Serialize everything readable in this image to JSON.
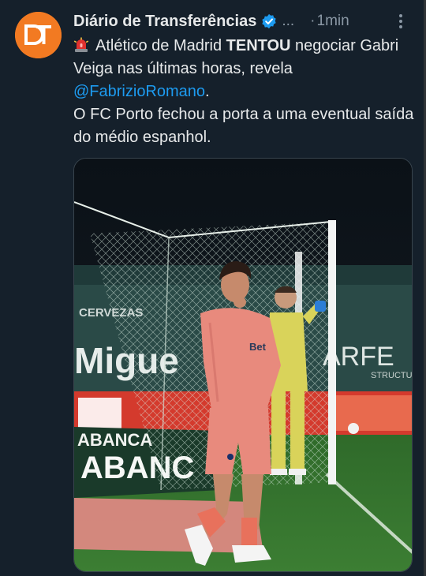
{
  "tweet": {
    "display_name": "Diário de Transferências",
    "handle_truncated": "...",
    "separator": "·",
    "time": "1min",
    "line1_pre": "Atlético de Madrid ",
    "line1_bold": "TENTOU",
    "line1_post": " negociar Gabri Veiga nas últimas horas, revela ",
    "mention": "@FabrizioRomano",
    "mention_suffix": ".",
    "line2": "O FC Porto fechou a porta a uma eventual saída do médio espanhol."
  },
  "media": {
    "stadium_sign_1": "CERVEZAS",
    "stadium_sign_2": "Migue",
    "stadium_sign_3": "ARFE",
    "stadium_sign_4": "STRUCTU",
    "ad_board_1": "ABANCA",
    "ad_board_2": "ABANC",
    "shirt_text": "Bet"
  },
  "colors": {
    "background": "#15202b",
    "avatar_orange": "#f27a22",
    "verified_blue": "#1d9bf0",
    "mention_blue": "#1d9bf0",
    "kit_pink": "#e88a7d",
    "keeper_yellow": "#d9d35a"
  },
  "icons": {
    "avatar": "dt-logo",
    "verified": "verified-badge-icon",
    "more": "more-options-icon",
    "siren": "siren-emoji-icon"
  }
}
